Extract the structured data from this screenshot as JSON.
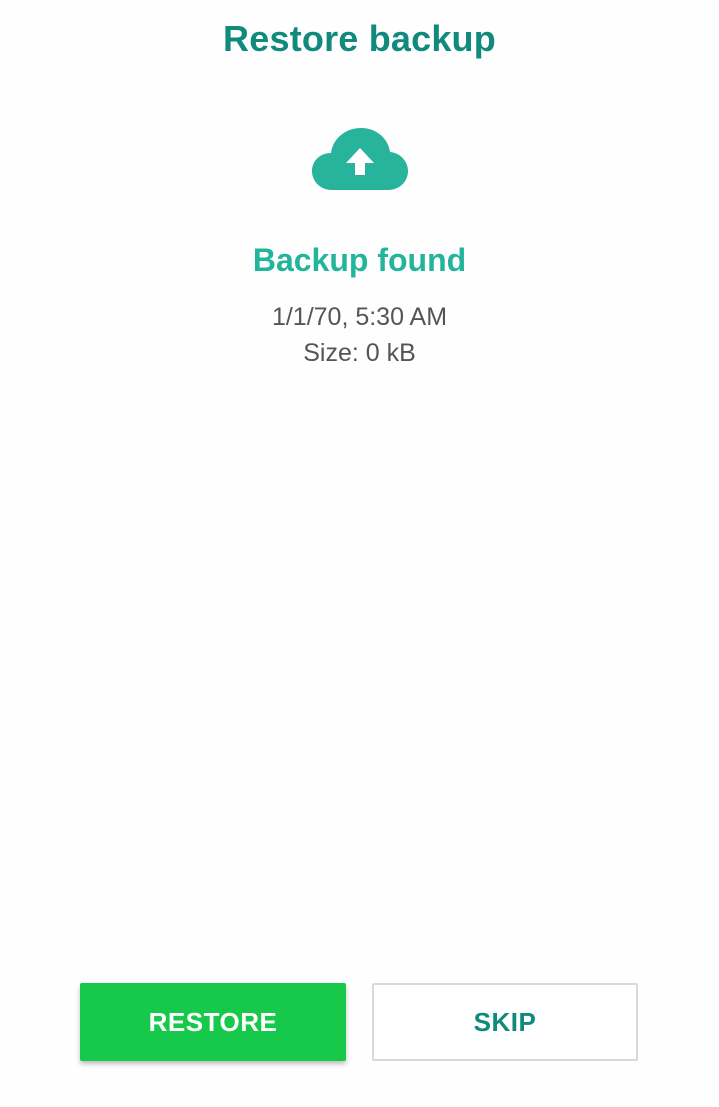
{
  "header": {
    "title": "Restore backup"
  },
  "backup": {
    "icon": "cloud-upload-icon",
    "status": "Backup found",
    "date": "1/1/70, 5:30 AM",
    "size": "Size: 0 kB"
  },
  "actions": {
    "restore_label": "RESTORE",
    "skip_label": "SKIP"
  },
  "colors": {
    "title": "#0f8a7c",
    "accent": "#22b59c",
    "restore_button": "#16c94b",
    "icon": "#27b39c"
  }
}
